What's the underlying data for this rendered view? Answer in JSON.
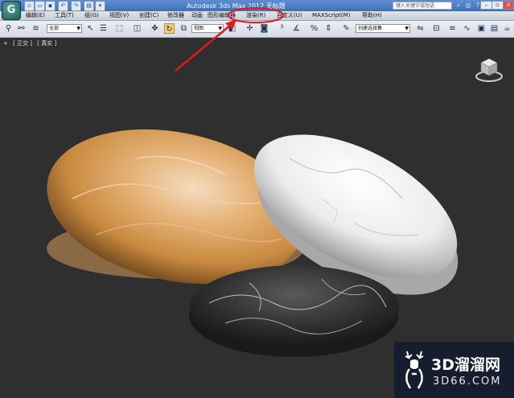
{
  "title_bar": {
    "app_logo_glyph": "G",
    "title": "Autodesk 3ds Max  2012     无标题",
    "search_placeholder": "键入关键字或短语"
  },
  "menu": {
    "items": [
      "编辑(E)",
      "工具(T)",
      "组(G)",
      "视图(V)",
      "创建(C)",
      "修改器",
      "动画",
      "图形编辑器",
      "渲染(R)",
      "自定义(U)",
      "MAXScript(M)",
      "帮助(H)"
    ]
  },
  "toolbar": {
    "selection_filter": "全部",
    "coord_system": "视图",
    "named_selection": "创建选择集"
  },
  "viewport": {
    "label_plus": "+",
    "label_view": "[ 正交 ]",
    "label_shading": "[ 真实 ]"
  },
  "annotation": {
    "highlighted_menu": "渲染(R)",
    "arrow_color": "#e0191b"
  },
  "watermark": {
    "big_text": "3D溜溜网",
    "small_text": "3D66.COM"
  },
  "colors": {
    "title_bar": "#4a7bc6",
    "viewport_bg": "#2f2f2f",
    "active_tool": "#f3d07a"
  }
}
